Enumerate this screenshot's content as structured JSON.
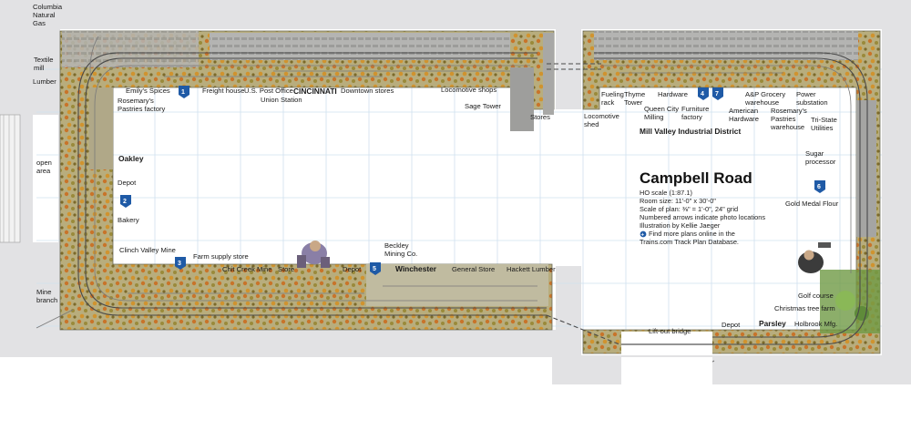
{
  "title": "Campbell Road",
  "info": {
    "scale": "HO scale (1:87.1)",
    "room_size": "Room size: 11'-0\" x 30'-0\"",
    "plan_scale": "Scale of plan: ⅜\" = 1'-0\", 24\" grid",
    "arrows_note": "Numbered arrows indicate photo locations",
    "illustration": "Illustration by Kellie Jaeger",
    "more_plans_line1": "Find more plans online in the",
    "more_plans_line2": "Trains.com Track Plan Database."
  },
  "districts": {
    "cincinnati": "CINCINNATI",
    "mill_valley": "Mill Valley Industrial District",
    "oakley": "Oakley",
    "winchester": "Winchester",
    "parsley": "Parsley"
  },
  "labels": {
    "columbia_1": "Columbia",
    "columbia_2": "Natural",
    "columbia_3": "Gas",
    "textile_1": "Textile",
    "textile_2": "mill",
    "lumber": "Lumber",
    "open_area_1": "open",
    "open_area_2": "area",
    "mine_branch_1": "Mine",
    "mine_branch_2": "branch",
    "emilys_spices": "Emily's Spices",
    "rosemarys_1": "Rosemary's",
    "rosemarys_2": "Pastries factory",
    "freight_house": "Freight house",
    "post_office": "U.S. Post Office",
    "union_station": "Union Station",
    "downtown_stores": "Downtown stores",
    "locomotive_shops": "Locomotive shops",
    "sage_tower": "Sage Tower",
    "stores": "Stores",
    "loco_shed_1": "Locomotive",
    "loco_shed_2": "shed",
    "fueling_1": "Fueling",
    "fueling_2": "rack",
    "thyme_1": "Thyme",
    "thyme_2": "Tower",
    "queen_city_1": "Queen City",
    "queen_city_2": "Milling",
    "hardware": "Hardware",
    "furniture_1": "Furniture",
    "furniture_2": "factory",
    "american_1": "American",
    "american_2": "Hardware",
    "grocery_1": "A&P Grocery",
    "grocery_2": "warehouse",
    "rosemarys_wh_1": "Rosemary's",
    "rosemarys_wh_2": "Pastries",
    "rosemarys_wh_3": "warehouse",
    "power_1": "Power",
    "power_2": "substation",
    "tristate_1": "Tri-State",
    "tristate_2": "Utilities",
    "sugar_1": "Sugar",
    "sugar_2": "processor",
    "gold_medal": "Gold Medal Flour",
    "depot_oakley": "Depot",
    "bakery": "Bakery",
    "clinch_valley": "Clinch Valley Mine",
    "farm_supply": "Farm supply store",
    "chit_creek": "Chit Creek Mine",
    "store": "Store",
    "beckley_1": "Beckley",
    "beckley_2": "Mining Co.",
    "depot_winchester": "Depot",
    "general_store": "General Store",
    "hackett": "Hackett Lumber",
    "golf": "Golf course",
    "christmas": "Christmas tree farm",
    "holbrook": "Holbrook Mfg.",
    "depot_parsley": "Depot",
    "liftout": "Lift-out bridge"
  },
  "photo_arrows": {
    "a1": "1",
    "a2": "2",
    "a3": "3",
    "a4": "4",
    "a5": "5",
    "a6": "6",
    "a7": "7"
  },
  "colors": {
    "wall": "#e2e2e4",
    "benchwork": "#c9b98a",
    "scenery_fall": "#c8742a",
    "track": "#4a4a4a",
    "grid": "#cfe0ef",
    "arrow": "#1f5aa6"
  }
}
